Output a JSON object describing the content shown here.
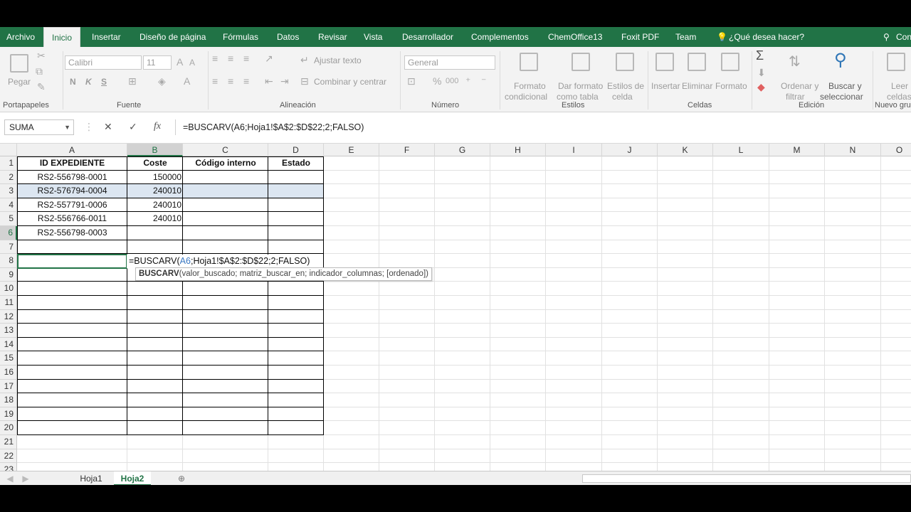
{
  "ribbon_tabs": [
    "Archivo",
    "Inicio",
    "Insertar",
    "Diseño de página",
    "Fórmulas",
    "Datos",
    "Revisar",
    "Vista",
    "Desarrollador",
    "Complementos",
    "ChemOffice13",
    "Foxit PDF",
    "Team"
  ],
  "tell_me": "¿Qué desea hacer?",
  "account": "Con",
  "ribbon": {
    "paste": "Pegar",
    "font_name": "Calibri",
    "font_size": "11",
    "bold": "N",
    "italic": "K",
    "underline": "S",
    "wrap_text": "Ajustar texto",
    "merge_center": "Combinar y centrar",
    "number_format": "General",
    "conditional_format_1": "Formato",
    "conditional_format_2": "condicional",
    "format_table_1": "Dar formato",
    "format_table_2": "como tabla",
    "cell_styles_1": "Estilos de",
    "cell_styles_2": "celda",
    "insert": "Insertar",
    "delete": "Eliminar",
    "format": "Formato",
    "sort_filter_1": "Ordenar y",
    "sort_filter_2": "filtrar",
    "find_select_1": "Buscar y",
    "find_select_2": "seleccionar",
    "read_1": "Leer",
    "read_2": "celdas",
    "groups": [
      "Portapapeles",
      "Fuente",
      "Alineación",
      "Número",
      "Estilos",
      "Celdas",
      "Edición",
      "Nuevo gru"
    ]
  },
  "name_box": "SUMA",
  "formula_bar": "=BUSCARV(A6;Hoja1!$A$2:$D$22;2;FALSO)",
  "columns": [
    "A",
    "B",
    "C",
    "D",
    "E",
    "F",
    "G",
    "H",
    "I",
    "J",
    "K",
    "L",
    "M",
    "N",
    "O"
  ],
  "rows": [
    "1",
    "2",
    "3",
    "4",
    "5",
    "6",
    "7",
    "8",
    "9",
    "10",
    "11",
    "12",
    "13",
    "14",
    "15",
    "16",
    "17",
    "18",
    "19",
    "20",
    "21",
    "22",
    "23"
  ],
  "table": {
    "headers": [
      "ID EXPEDIENTE",
      "Coste",
      "Código interno",
      "Estado"
    ],
    "ids": [
      "RS2-556798-0001",
      "RS2-576794-0004",
      "RS2-557791-0006",
      "RS2-556766-0011",
      "RS2-556798-0003"
    ],
    "costs": [
      "150000",
      "240010",
      "240010",
      "240010"
    ]
  },
  "editing": {
    "prefix": "=BUSCARV(",
    "ref": "A6",
    "suffix": ";Hoja1!$A$2:$D$22;2;FALSO)"
  },
  "tooltip": {
    "fn": "BUSCARV",
    "args": "(valor_buscado; matriz_buscar_en; indicador_columnas; [ordenado])"
  },
  "sheets": [
    "Hoja1",
    "Hoja2"
  ],
  "colors": {
    "accent": "#217346",
    "header_fill": "#dce6f1",
    "ref_blue": "#3a78c3"
  }
}
